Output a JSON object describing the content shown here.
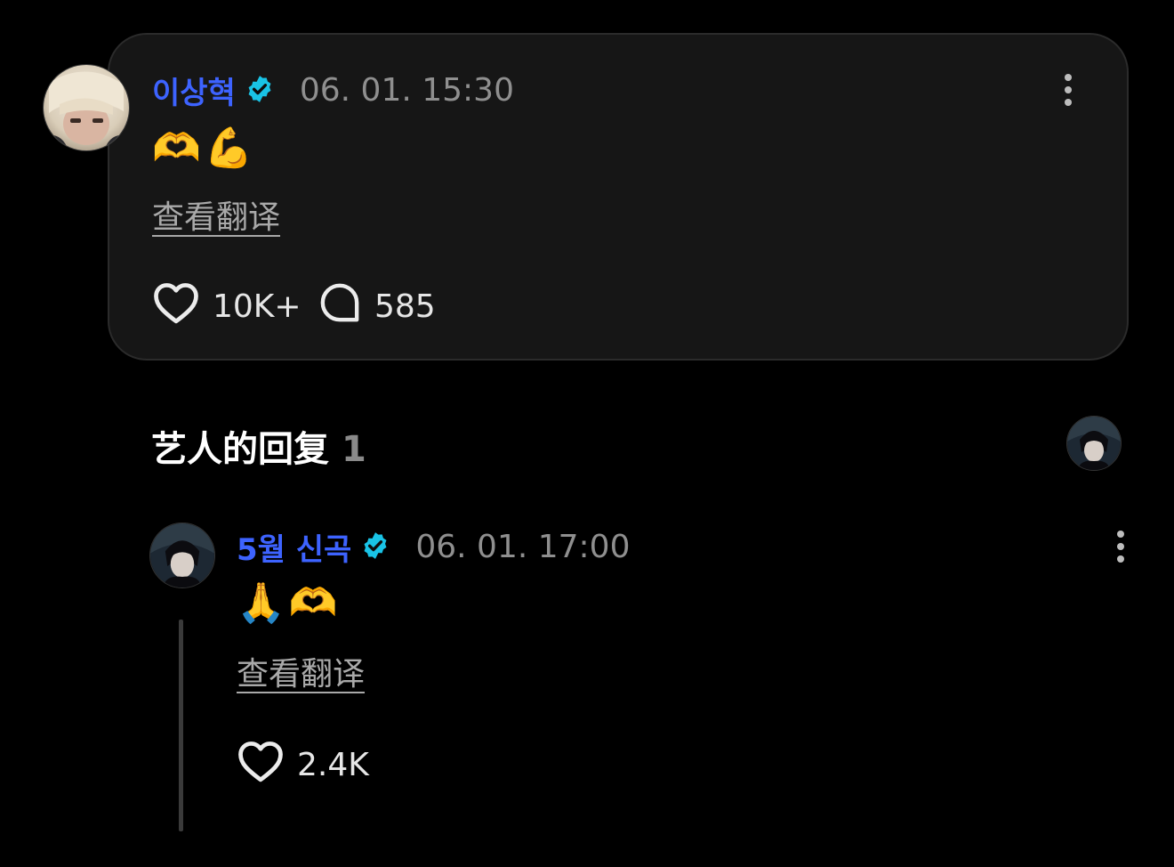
{
  "post": {
    "username": "이상혁",
    "timestamp": "06. 01. 15:30",
    "content": "🫶💪",
    "translate_label": "查看翻译",
    "likes": "10K+",
    "comments": "585"
  },
  "replies_section": {
    "title": "艺人的回复",
    "count": "1"
  },
  "reply": {
    "username": "5월 신곡",
    "timestamp": "06. 01. 17:00",
    "content": "🙏🫶",
    "translate_label": "查看翻译",
    "likes": "2.4K"
  },
  "icons": {
    "verified": "verified-badge-icon",
    "like": "heart-icon",
    "comment": "comment-bubble-icon",
    "more": "more-vertical-icon"
  },
  "colors": {
    "username": "#3d63ff",
    "verified_badge": "#19c3e6",
    "card_background": "#161616",
    "page_background": "#000000"
  }
}
